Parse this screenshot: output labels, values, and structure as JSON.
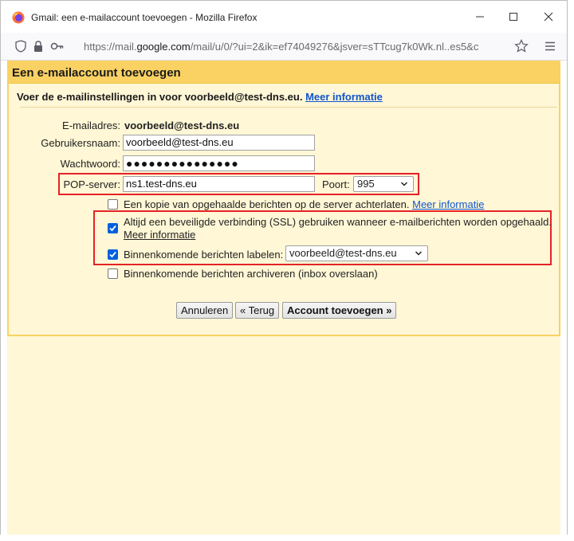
{
  "window": {
    "title": "Gmail: een e-mailaccount toevoegen - Mozilla Firefox",
    "url_prefix": "https://mail.",
    "url_domain": "google.com",
    "url_rest": "/mail/u/0/?ui=2&ik=ef74049276&jsver=sTTcug7k0Wk.nl..es5&c"
  },
  "dialog": {
    "title": "Een e-mailaccount toevoegen",
    "intro": "Voer de e-mailinstellingen in voor voorbeeld@test-dns.eu.",
    "intro_link": "Meer informatie",
    "fields": {
      "email_label": "E-mailadres:",
      "email_value": "voorbeeld@test-dns.eu",
      "username_label": "Gebruikersnaam:",
      "username_value": "voorbeeld@test-dns.eu",
      "password_label": "Wachtwoord:",
      "password_value": "●●●●●●●●●●●●●●●",
      "pop_label": "POP-server:",
      "pop_value": "ns1.test-dns.eu",
      "port_label": "Poort:",
      "port_value": "995"
    },
    "options": {
      "copy_label": "Een kopie van opgehaalde berichten op de server achterlaten.",
      "copy_link": "Meer informatie",
      "copy_checked": false,
      "ssl_label": "Altijd een beveiligde verbinding (SSL) gebruiken wanneer e-mailberichten worden opgehaald.",
      "ssl_link": "Meer informatie",
      "ssl_checked": true,
      "labels_label": "Binnenkomende berichten labelen:",
      "labels_value": "voorbeeld@test-dns.eu",
      "labels_checked": true,
      "archive_label": "Binnenkomende berichten archiveren (inbox overslaan)",
      "archive_checked": false
    },
    "buttons": {
      "cancel": "Annuleren",
      "back": "« Terug",
      "add": "Account toevoegen »"
    }
  },
  "colors": {
    "header_bg": "#fad163",
    "body_bg": "#fff7d6",
    "highlight_border": "#e52326",
    "checkbox_checked": "#0060df",
    "link": "#1155cc"
  }
}
